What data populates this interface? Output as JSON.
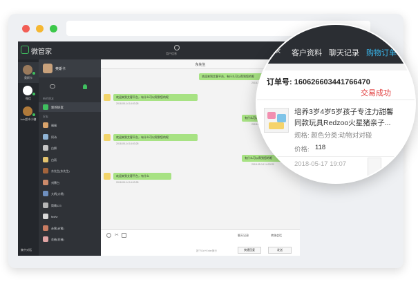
{
  "app": {
    "brand": "微管家",
    "profile_label": "用户信息",
    "accounts": [
      {
        "name": "奥斯卡",
        "color": "#9a7a5c"
      },
      {
        "name": "微信",
        "color": "#ffffff"
      },
      {
        "name": "bob超市小糖",
        "color": "#b07a3a"
      }
    ],
    "footer_label": "集中对话"
  },
  "contacts": {
    "chat_title": "奥斯卡",
    "section_new": "新的朋友",
    "new_friend_label": "新的好友",
    "section_friends": "好友",
    "friends": [
      {
        "name": "福福",
        "color": "#d9a36b"
      },
      {
        "name": "阿诗",
        "color": "#8fb4d6"
      },
      {
        "name": "白狮",
        "color": "#c6c6c6"
      },
      {
        "name": "白雨",
        "color": "#e3c36e"
      },
      {
        "name": "东先生(东先生)",
        "color": "#a3643c"
      },
      {
        "name": "刘慕白",
        "color": "#cc8a6a"
      },
      {
        "name": "大柄(大柄)",
        "color": "#6e8fbf"
      },
      {
        "name": "简晴123",
        "color": "#b6b6b6"
      },
      {
        "name": "fasfw",
        "color": "#d8d8d8"
      },
      {
        "name": "赤霄(赤霄)",
        "color": "#c97c62"
      },
      {
        "name": "花袖(花袖)",
        "color": "#e0a4a4"
      }
    ]
  },
  "conversation": {
    "title": "东先生",
    "messages": [
      {
        "dir": "out",
        "text": "欢迎来到艾客平台，有什么可以帮到您的呢",
        "time": "2018-05-14 14:03:25"
      },
      {
        "dir": "in",
        "text": "欢迎来到艾客平台，有什么可以帮到您的呢",
        "time": "2018-05-14 14:03:25"
      },
      {
        "dir": "out",
        "text": "有什么可以帮到您的呢",
        "time": "2018-05-14 14:03:25"
      },
      {
        "dir": "in",
        "text": "欢迎来到艾客平台，有什么可以帮到您的呢",
        "time": "2018-05-14 14:03:25"
      },
      {
        "dir": "out",
        "text": "有什么可以帮到您的呢",
        "time": "2018-05-14 14:03:25"
      },
      {
        "dir": "in",
        "text": "欢迎来到艾客平台，有什么",
        "time": "2018-05-14 14:03:25"
      }
    ],
    "toolbar": {
      "history": "聊天记录",
      "transfer": "转移会话"
    },
    "hint": "按下Ctrl+Enter换行",
    "buttons": {
      "quick_reply": "快捷回复",
      "send": "发送"
    }
  },
  "order_panel": {
    "tabs": [
      "客户资料",
      "聊天记录",
      "购物订单"
    ],
    "active_tab": "购物订单",
    "order_no_label": "订单号:",
    "order_no": "160626603441766470",
    "status": "交易成功",
    "product_title_line1": "培养3岁4岁5岁孩子专注力甜馨",
    "product_title_line2": "同款玩具Redzoo火星猪亲子...",
    "spec_label": "规格:",
    "spec_value": "颜色分类:动物对对碰",
    "price_label": "价格:",
    "price": "118",
    "date": "2018-05-17 19:07",
    "accent_color": "#39b8ee",
    "status_color": "#e03a3a"
  }
}
